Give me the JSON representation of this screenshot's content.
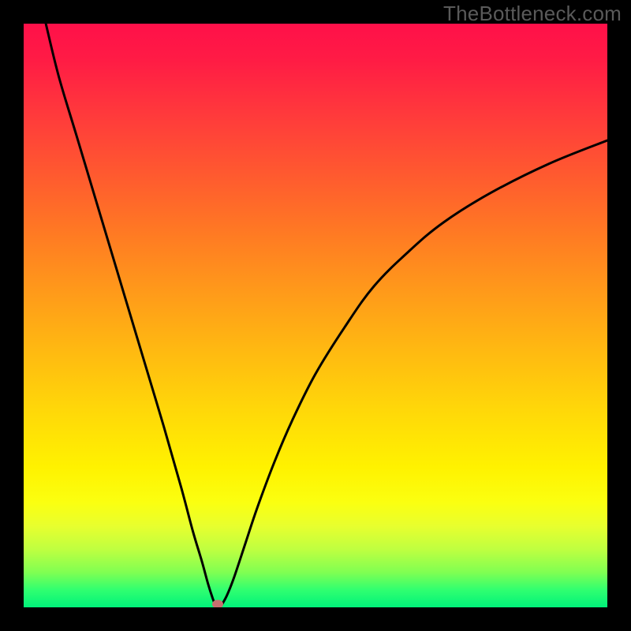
{
  "watermark_text": "TheBottleneck.com",
  "colors": {
    "frame": "#000000",
    "watermark": "#5a5a5a",
    "curve_stroke": "#000000",
    "marker_fill": "#c67070",
    "gradient_top": "#ff1049",
    "gradient_bottom": "#00f27a"
  },
  "chart_data": {
    "type": "line",
    "title": "",
    "xlabel": "",
    "ylabel": "",
    "xlim": [
      0,
      100
    ],
    "ylim": [
      0,
      100
    ],
    "grid": false,
    "notes": "Bottleneck-style V curve on a heat gradient; minimum near x≈33, left branch steep to y=100, right branch asymptotic toward y≈80.",
    "series": [
      {
        "name": "left_branch",
        "x": [
          3.8,
          6,
          9,
          12,
          15,
          18,
          21,
          24,
          27,
          29,
          30.5,
          31.6,
          32.4,
          32.9
        ],
        "values": [
          100,
          91,
          81,
          71,
          61,
          51,
          41,
          31,
          20.5,
          13,
          8,
          4,
          1.5,
          0.2
        ]
      },
      {
        "name": "right_branch",
        "x": [
          33.8,
          34.8,
          36,
          38,
          40,
          43,
          46,
          50,
          55,
          60,
          66,
          72,
          80,
          90,
          100
        ],
        "values": [
          0.2,
          2,
          5,
          11,
          17,
          25,
          32,
          40,
          48,
          55,
          61,
          66,
          71,
          76,
          80
        ]
      }
    ],
    "marker": {
      "x": 33.3,
      "y": 0.6
    }
  }
}
